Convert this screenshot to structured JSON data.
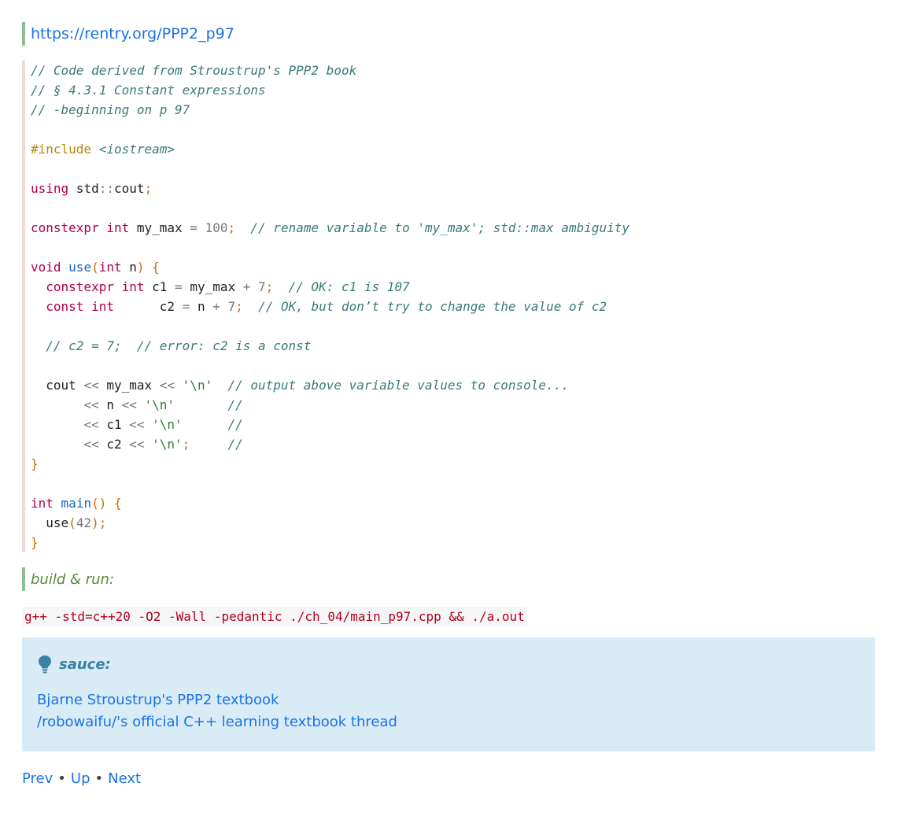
{
  "top_link": "https://rentry.org/PPP2_p97",
  "code_lines": [
    [
      {
        "t": "// Code derived from Stroustrup's PPP2 book",
        "c": "c-com"
      }
    ],
    [
      {
        "t": "// § 4.3.1 Constant expressions",
        "c": "c-com"
      }
    ],
    [
      {
        "t": "// -beginning on p 97",
        "c": "c-com"
      }
    ],
    [],
    [
      {
        "t": "#include",
        "c": "c-pre"
      },
      {
        "t": " "
      },
      {
        "t": "<iostream>",
        "c": "c-hdr"
      }
    ],
    [],
    [
      {
        "t": "using",
        "c": "c-kw"
      },
      {
        "t": " std",
        "c": "c-id"
      },
      {
        "t": "::",
        "c": "c-op"
      },
      {
        "t": "cout",
        "c": "c-id"
      },
      {
        "t": ";",
        "c": "c-pun"
      }
    ],
    [],
    [
      {
        "t": "constexpr",
        "c": "c-kw"
      },
      {
        "t": " "
      },
      {
        "t": "int",
        "c": "c-kw"
      },
      {
        "t": " my_max ",
        "c": "c-id"
      },
      {
        "t": "=",
        "c": "c-op"
      },
      {
        "t": " "
      },
      {
        "t": "100",
        "c": "c-num"
      },
      {
        "t": ";",
        "c": "c-pun"
      },
      {
        "t": "  "
      },
      {
        "t": "// rename variable to 'my_max'; std::max ambiguity",
        "c": "c-com"
      }
    ],
    [],
    [
      {
        "t": "void",
        "c": "c-kw"
      },
      {
        "t": " "
      },
      {
        "t": "use",
        "c": "c-fn"
      },
      {
        "t": "(",
        "c": "c-pun"
      },
      {
        "t": "int",
        "c": "c-kw"
      },
      {
        "t": " n",
        "c": "c-id"
      },
      {
        "t": ")",
        "c": "c-pun"
      },
      {
        "t": " "
      },
      {
        "t": "{",
        "c": "c-pun"
      }
    ],
    [
      {
        "t": "  "
      },
      {
        "t": "constexpr",
        "c": "c-kw"
      },
      {
        "t": " "
      },
      {
        "t": "int",
        "c": "c-kw"
      },
      {
        "t": " c1 ",
        "c": "c-id"
      },
      {
        "t": "=",
        "c": "c-op"
      },
      {
        "t": " my_max ",
        "c": "c-id"
      },
      {
        "t": "+",
        "c": "c-op"
      },
      {
        "t": " "
      },
      {
        "t": "7",
        "c": "c-num"
      },
      {
        "t": ";",
        "c": "c-pun"
      },
      {
        "t": "  "
      },
      {
        "t": "// OK: c1 is 107",
        "c": "c-com"
      }
    ],
    [
      {
        "t": "  "
      },
      {
        "t": "const",
        "c": "c-kw"
      },
      {
        "t": " "
      },
      {
        "t": "int",
        "c": "c-kw"
      },
      {
        "t": "      c2 ",
        "c": "c-id"
      },
      {
        "t": "=",
        "c": "c-op"
      },
      {
        "t": " n ",
        "c": "c-id"
      },
      {
        "t": "+",
        "c": "c-op"
      },
      {
        "t": " "
      },
      {
        "t": "7",
        "c": "c-num"
      },
      {
        "t": ";",
        "c": "c-pun"
      },
      {
        "t": "  "
      },
      {
        "t": "// OK, but don’t try to change the value of c2",
        "c": "c-com"
      }
    ],
    [],
    [
      {
        "t": "  "
      },
      {
        "t": "// c2 = 7;  // error: c2 is a const",
        "c": "c-com"
      }
    ],
    [],
    [
      {
        "t": "  cout ",
        "c": "c-id"
      },
      {
        "t": "<<",
        "c": "c-op"
      },
      {
        "t": " my_max ",
        "c": "c-id"
      },
      {
        "t": "<<",
        "c": "c-op"
      },
      {
        "t": " "
      },
      {
        "t": "'\\n'",
        "c": "c-str"
      },
      {
        "t": "  "
      },
      {
        "t": "// output above variable values to console...",
        "c": "c-com"
      }
    ],
    [
      {
        "t": "       "
      },
      {
        "t": "<<",
        "c": "c-op"
      },
      {
        "t": " n ",
        "c": "c-id"
      },
      {
        "t": "<<",
        "c": "c-op"
      },
      {
        "t": " "
      },
      {
        "t": "'\\n'",
        "c": "c-str"
      },
      {
        "t": "       "
      },
      {
        "t": "//",
        "c": "c-com"
      }
    ],
    [
      {
        "t": "       "
      },
      {
        "t": "<<",
        "c": "c-op"
      },
      {
        "t": " c1 ",
        "c": "c-id"
      },
      {
        "t": "<<",
        "c": "c-op"
      },
      {
        "t": " "
      },
      {
        "t": "'\\n'",
        "c": "c-str"
      },
      {
        "t": "      "
      },
      {
        "t": "//",
        "c": "c-com"
      }
    ],
    [
      {
        "t": "       "
      },
      {
        "t": "<<",
        "c": "c-op"
      },
      {
        "t": " c2 ",
        "c": "c-id"
      },
      {
        "t": "<<",
        "c": "c-op"
      },
      {
        "t": " "
      },
      {
        "t": "'\\n'",
        "c": "c-str"
      },
      {
        "t": ";",
        "c": "c-pun"
      },
      {
        "t": "     "
      },
      {
        "t": "//",
        "c": "c-com"
      }
    ],
    [
      {
        "t": "}",
        "c": "c-pun"
      }
    ],
    [],
    [
      {
        "t": "int",
        "c": "c-kw"
      },
      {
        "t": " "
      },
      {
        "t": "main",
        "c": "c-fn"
      },
      {
        "t": "()",
        "c": "c-pun"
      },
      {
        "t": " "
      },
      {
        "t": "{",
        "c": "c-pun"
      }
    ],
    [
      {
        "t": "  use",
        "c": "c-id"
      },
      {
        "t": "(",
        "c": "c-pun"
      },
      {
        "t": "42",
        "c": "c-num"
      },
      {
        "t": ");",
        "c": "c-pun"
      }
    ],
    [
      {
        "t": "}",
        "c": "c-pun"
      }
    ]
  ],
  "build_label": "build & run:",
  "command": "g++ -std=c++20 -O2 -Wall -pedantic ./ch_04/main_p97.cpp && ./a.out",
  "admonition": {
    "icon": "lightbulb-icon",
    "title": "sauce:",
    "links": [
      "Bjarne Stroustrup's PPP2 textbook",
      "/robowaifu/'s official C++ learning textbook thread"
    ]
  },
  "nav": {
    "prev": "Prev",
    "up": "Up",
    "next": "Next",
    "separator": "•"
  }
}
